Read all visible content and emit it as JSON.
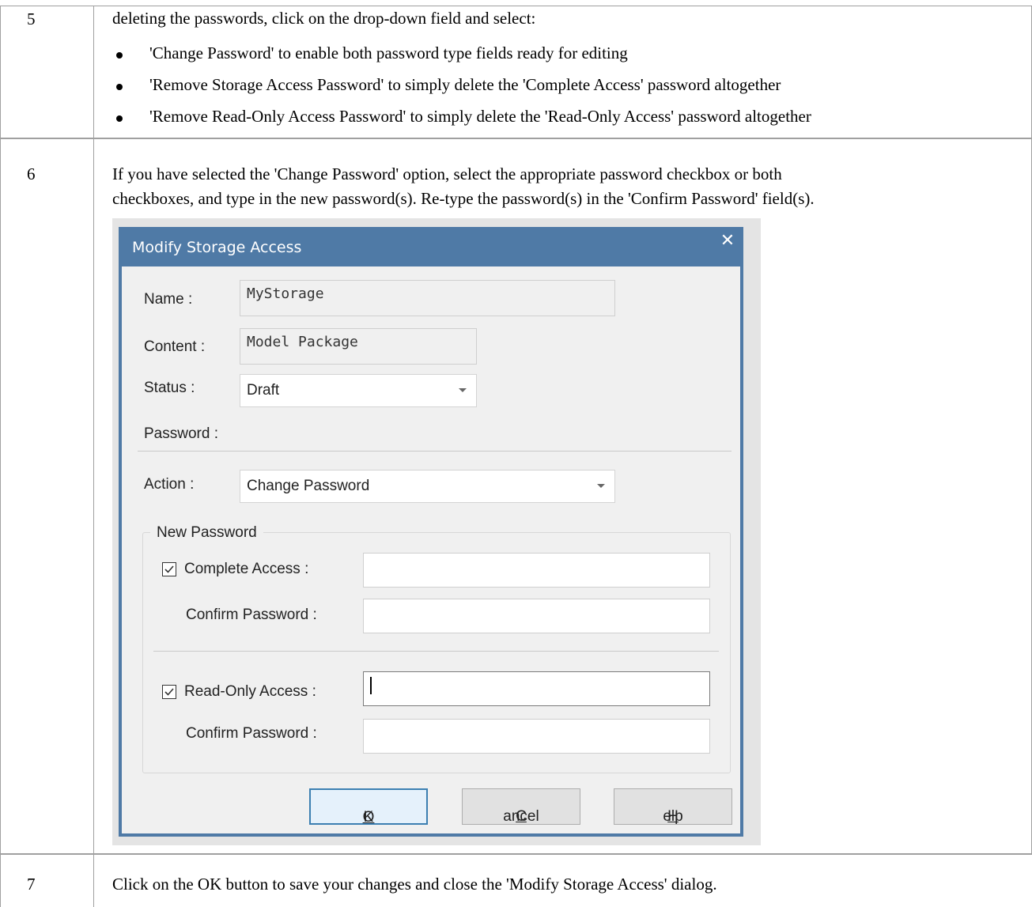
{
  "rows": [
    {
      "number": "5",
      "intro": "deleting the passwords, click on the drop-down field and select:",
      "bullets": [
        "'Change Password' to enable both password type fields ready for editing",
        "'Remove Storage Access Password' to simply delete the 'Complete Access' password altogether",
        "'Remove Read-Only Access Password' to simply delete the 'Read-Only Access' password altogether"
      ]
    },
    {
      "number": "6",
      "line1": "If you have selected the 'Change Password' option, select the appropriate password checkbox or both",
      "line2": "checkboxes, and type in the new password(s). Re-type the password(s) in the 'Confirm Password' field(s)."
    },
    {
      "number": "7",
      "text": "Click on the OK button to save your changes and close the 'Modify Storage Access' dialog."
    }
  ],
  "dialog": {
    "title": "Modify Storage Access",
    "close_glyph": "✕",
    "name_label": "Name :",
    "name_value": "MyStorage",
    "content_label": "Content :",
    "content_value": "Model Package",
    "status_label": "Status :",
    "status_value": "Draft",
    "password_label": "Password :",
    "action_label": "Action :",
    "action_value": "Change Password",
    "group_label": "New Password",
    "complete_access_label": "Complete Access :",
    "complete_access_checked": true,
    "confirm_password_label": "Confirm Password :",
    "readonly_access_label": "Read-Only Access :",
    "readonly_access_checked": true,
    "confirm_password_label_2": "Confirm Password :",
    "ok_mnemonic": "O",
    "ok_rest": "K",
    "cancel_mnemonic": "C",
    "cancel_rest": "ancel",
    "help_mnemonic": "H",
    "help_rest": "elp",
    "accent": "#4f7aa6"
  }
}
